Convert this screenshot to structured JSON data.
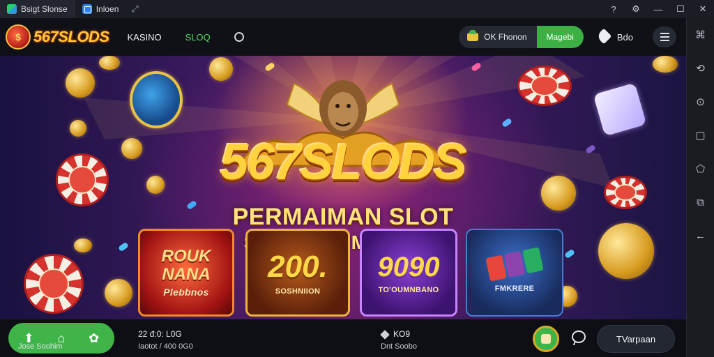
{
  "window": {
    "tabs": [
      {
        "label": "Bsigt Slonse",
        "icon": "app-store-icon"
      },
      {
        "label": "Inloen",
        "icon": "window-icon"
      }
    ],
    "expand_glyph": "⤢",
    "controls": {
      "help": "?",
      "settings": "⚙",
      "minimize": "—",
      "maximize": "☐",
      "close": "✕"
    }
  },
  "header": {
    "brand": "567SLODS",
    "logo_glyph": "$",
    "nav": [
      "KASINO",
      "SLOQ"
    ],
    "balance_text": "OK Fhonon",
    "login_label": "Magebi",
    "user_text": "Bdo"
  },
  "sidebar": {
    "icons": [
      "⌘",
      "⟲",
      "⊙",
      "▢",
      "⬠",
      "⧉",
      "←"
    ]
  },
  "hero": {
    "title": "567SLODS",
    "subtitle_line1": "PERMAIMAN SLOT",
    "subtitle_line2": "SERU DAN MENARIK",
    "cards": [
      {
        "big": "ROUK NANA",
        "caption": "Plebbnos"
      },
      {
        "big": "200.",
        "caption": "SOSHNIION"
      },
      {
        "big": "9090",
        "caption": "TO'OUMNBANO"
      },
      {
        "big": "",
        "caption": "FMKRERE"
      }
    ]
  },
  "bottom": {
    "quick_actions": [
      "⬆",
      "⌂",
      "✿"
    ],
    "quick_label": "Jose Soohim",
    "stat1_top": "22 đ:0: L0G",
    "stat1_bottom": "Iaotot / 400 0G0",
    "stat2_top": "KO9",
    "stat2_bottom": "Dnt Soobo",
    "register_label": "TVarpaan"
  },
  "colors": {
    "accent_green": "#3fb549",
    "gold": "#ffd23e",
    "header_bg": "#0f1117"
  }
}
